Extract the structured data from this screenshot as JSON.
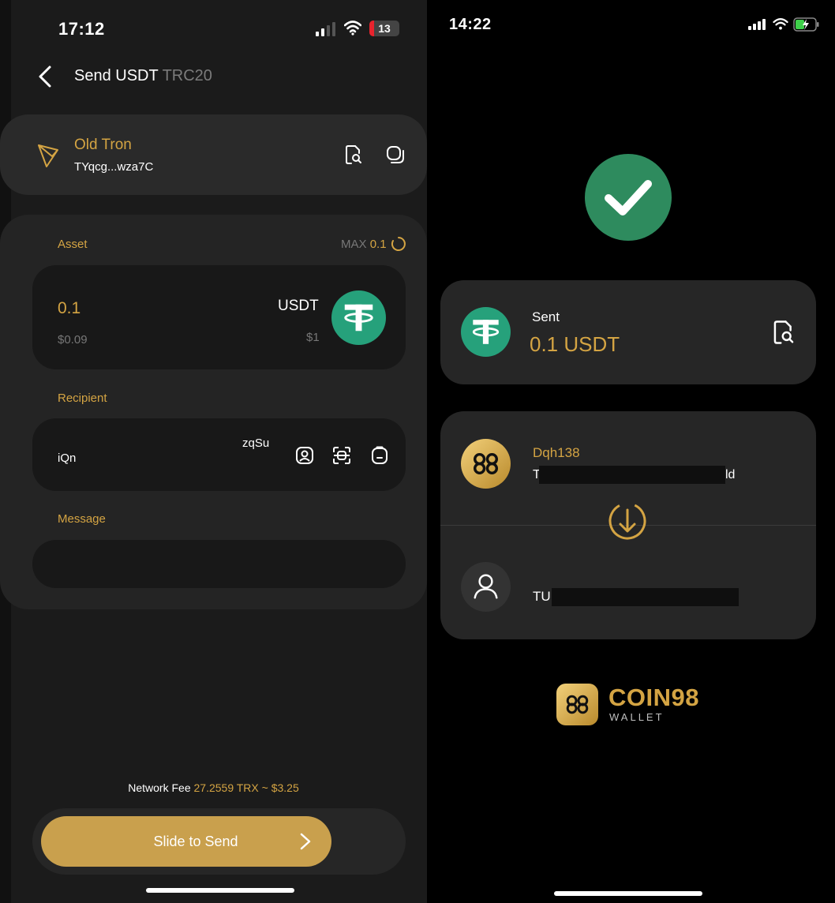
{
  "left_screen": {
    "status": {
      "time": "17:12",
      "battery": "13"
    },
    "header": {
      "title": "Send USDT",
      "subtitle": "TRC20"
    },
    "wallet": {
      "name": "Old Tron",
      "address": "TYqcg...wza7C"
    },
    "form": {
      "asset_label": "Asset",
      "max_label": "MAX",
      "max_value": "0.1",
      "amount": "0.1",
      "amount_usd": "$0.09",
      "asset_symbol": "USDT",
      "asset_price": "$1",
      "recipient_label": "Recipient",
      "recipient_line1": "zqSu",
      "recipient_line2": "iQn",
      "message_label": "Message"
    },
    "fee": {
      "label": "Network Fee",
      "value": "27.2559 TRX ~ $3.25"
    },
    "slide_label": "Slide to Send"
  },
  "right_screen": {
    "status": {
      "time": "14:22"
    },
    "sent": {
      "label": "Sent",
      "amount": "0.1 USDT"
    },
    "from": {
      "name": "Dqh138",
      "address_start": "T",
      "address_end": "ld"
    },
    "to": {
      "address": "TU"
    },
    "brand": {
      "name": "COIN98",
      "sub": "WALLET"
    }
  },
  "colors": {
    "accent": "#d4a443",
    "tether": "#26a17b",
    "success": "#2e8b5e"
  }
}
